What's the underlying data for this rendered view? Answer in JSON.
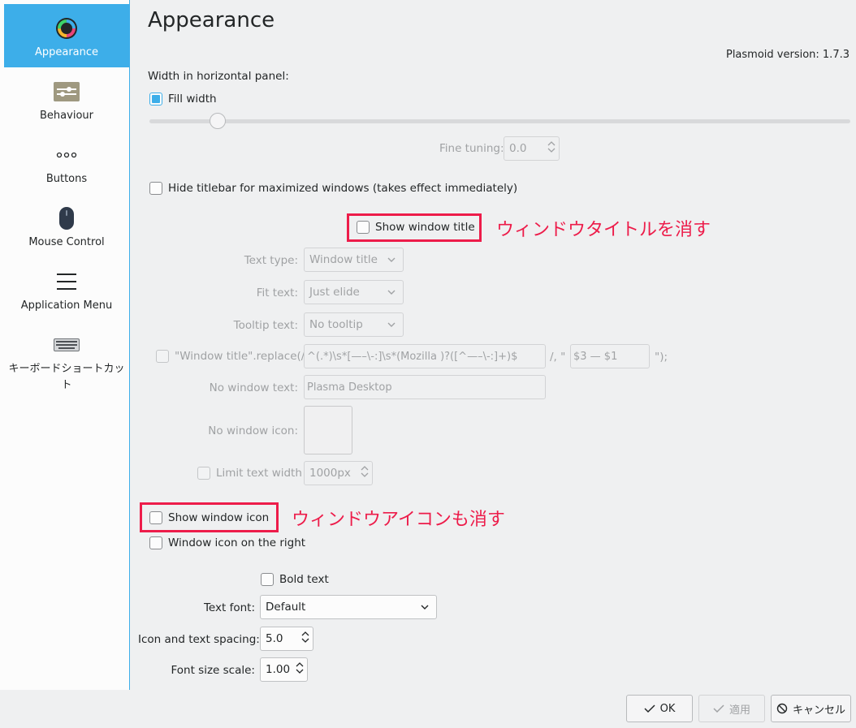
{
  "sidebar": {
    "items": [
      {
        "label": "Appearance",
        "icon": "color-wheel-icon",
        "active": true
      },
      {
        "label": "Behaviour",
        "icon": "preferences-icon"
      },
      {
        "label": "Buttons",
        "icon": "dots-icon"
      },
      {
        "label": "Mouse Control",
        "icon": "mouse-icon"
      },
      {
        "label": "Application Menu",
        "icon": "hamburger-menu-icon"
      },
      {
        "label": "キーボードショートカット",
        "icon": "keyboard-icon"
      }
    ]
  },
  "page": {
    "title": "Appearance",
    "version": "Plasmoid version: 1.7.3"
  },
  "width": {
    "label": "Width in horizontal panel:",
    "fill_width": "Fill width",
    "fine_tuning_label": "Fine tuning:",
    "fine_tuning_value": "0.0"
  },
  "hide_titlebar": "Hide titlebar for maximized windows (takes effect immediately)",
  "show_window_title": "Show window title",
  "annotation_title": "ウィンドウタイトルを消す",
  "text_type": {
    "label": "Text type:",
    "value": "Window title"
  },
  "fit_text": {
    "label": "Fit text:",
    "value": "Just elide"
  },
  "tooltip_text": {
    "label": "Tooltip text:",
    "value": "No tooltip"
  },
  "replace": {
    "label": "\"Window title\".replace(/",
    "regex": "^(.*)\\s*[—–\\-:]\\s*(Mozilla )?([^—–\\-:]+)$",
    "sep": "/, \"",
    "replacement": "$3 — $1",
    "end": "\");"
  },
  "no_window_text": {
    "label": "No window text:",
    "value": "Plasma Desktop"
  },
  "no_window_icon": {
    "label": "No window icon:"
  },
  "limit_text_width": {
    "label": "Limit text width",
    "value": "1000px"
  },
  "show_window_icon": "Show window icon",
  "annotation_icon": "ウィンドウアイコンも消す",
  "icon_on_right": "Window icon on the right",
  "bold_text": "Bold text",
  "text_font": {
    "label": "Text font:",
    "value": "Default"
  },
  "icon_spacing": {
    "label": "Icon and text spacing:",
    "value": "5.0"
  },
  "font_scale": {
    "label": "Font size scale:",
    "value": "1.00"
  },
  "buttons": {
    "ok": "OK",
    "apply": "適用",
    "cancel": "キャンセル"
  },
  "colors": {
    "accent": "#3daee9",
    "annotation": "#ed1c4a"
  }
}
